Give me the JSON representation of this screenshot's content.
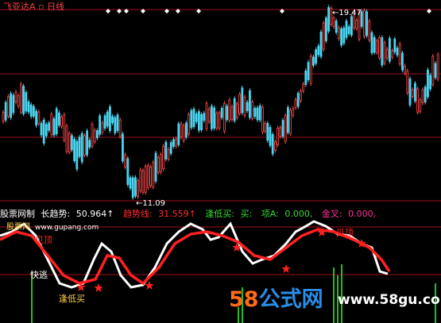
{
  "header": {
    "stock_name": "飞亚达A",
    "period": "日线"
  },
  "price_panel": {
    "high_label": "19.47",
    "low_label": "11.09"
  },
  "indicator_bar": {
    "name": "股票网制",
    "items": [
      {
        "label": "长趋势:",
        "value": "50.964↑",
        "color": "#ffffff"
      },
      {
        "label": "趋势线:",
        "value": "31.559↑",
        "color": "#ff3030"
      },
      {
        "label": "逢低买:",
        "value": "买:",
        "color": "#33dd33"
      },
      {
        "label": "项A:",
        "value": "0.000,",
        "color": "#33dd33"
      },
      {
        "label": "金叉:",
        "value": "0.000,",
        "color": "#ff3399"
      }
    ]
  },
  "signals": {
    "kuaitao": "快逃",
    "dixi": "逢低买",
    "ding": "见顶",
    "ding2": "见顶"
  },
  "watermark": {
    "logo_a": "58",
    "logo_b": "公式网",
    "url": "www.58gu.com",
    "small_site": "股票网",
    "small_url": "www.gupang.com"
  },
  "colors": {
    "up": "#ff4a4a",
    "down": "#4ad4f0",
    "long_trend": "#ffffff",
    "trend_line": "#ff2020",
    "guide": "#a01020"
  },
  "chart_data": {
    "type": "candlestick",
    "title": "飞亚达A 日线",
    "price_high": 19.47,
    "price_low": 11.09,
    "indicator_lines": [
      {
        "name": "长趋势",
        "last_value": 50.964
      },
      {
        "name": "趋势线",
        "last_value": 31.559
      }
    ]
  }
}
